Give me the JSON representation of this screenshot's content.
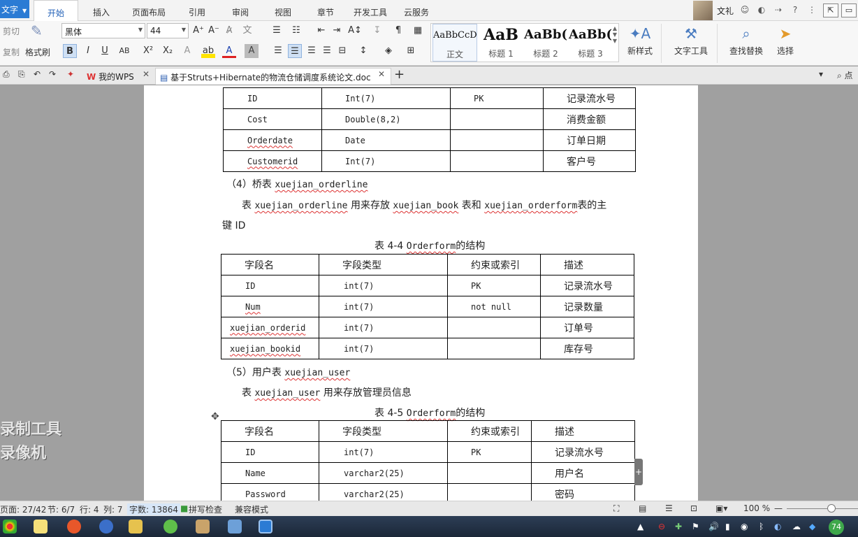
{
  "app_button": "文字",
  "menu_tabs": [
    "开始",
    "插入",
    "页面布局",
    "引用",
    "审阅",
    "视图",
    "章节",
    "开发工具",
    "云服务"
  ],
  "menu_right": {
    "user": "文礼"
  },
  "ribbon": {
    "cut": "剪切",
    "copy": "复制",
    "format_painter": "格式刷",
    "font_name": "黑体",
    "font_size": "44",
    "styles": [
      {
        "sample": "AaBbCcD",
        "name": "正文"
      },
      {
        "sample": "AaB",
        "name": "标题 1"
      },
      {
        "sample": "AaBb(",
        "name": "标题 2"
      },
      {
        "sample": "AaBb(",
        "name": "标题 3"
      }
    ],
    "new_style": "新样式",
    "text_tools": "文字工具",
    "find_replace": "查找替换",
    "select": "选择"
  },
  "tabs": [
    {
      "label": "我的WPS"
    },
    {
      "label": "基于Struts+Hibernate的物流仓储调度系统论文.doc"
    }
  ],
  "doc": {
    "table1": [
      [
        "ID",
        "Int(7)",
        "PK",
        "记录流水号"
      ],
      [
        "Cost",
        "Double(8,2)",
        "",
        "消费金额"
      ],
      [
        "Orderdate",
        "Date",
        "",
        "订单日期"
      ],
      [
        "Customerid",
        "Int(7)",
        "",
        "客户号"
      ]
    ],
    "heading4_prefix": "（4）桥表",
    "heading4_name": "xuejian_orderline",
    "para4": {
      "p1": "表",
      "t1": "xuejian_orderline",
      "p2": "用来存放",
      "t2": "xuejian_book",
      "p3": "表和",
      "t3": "xuejian_orderform",
      "p4": "表的主",
      "line2": "键 ID"
    },
    "caption44": {
      "prefix": "表 4-4",
      "name": "Orderform",
      "suffix": "的结构"
    },
    "table2_header": [
      "字段名",
      "字段类型",
      "约束或索引",
      "描述"
    ],
    "table2": [
      [
        "ID",
        "int(7)",
        "PK",
        "记录流水号"
      ],
      [
        "Num",
        "int(7)",
        "not null",
        "记录数量"
      ],
      [
        "xuejian_orderid",
        "int(7)",
        "",
        "订单号"
      ],
      [
        "xuejian_bookid",
        "int(7)",
        "",
        "库存号"
      ]
    ],
    "heading5_prefix": "（5）用户表",
    "heading5_name": "xuejian_user",
    "para5": {
      "p1": "表",
      "t1": "xuejian_user",
      "p2": "用来存放管理员信息"
    },
    "caption45": {
      "prefix": "表 4-5",
      "name": "Orderform",
      "suffix": "的结构"
    },
    "table3_header": [
      "字段名",
      "字段类型",
      "约束或索引",
      "描述"
    ],
    "table3": [
      [
        "ID",
        "int(7)",
        "PK",
        "记录流水号"
      ],
      [
        "Name",
        "varchar2(25)",
        "",
        "用户名"
      ],
      [
        "Password",
        "varchar2(25)",
        "",
        "密码"
      ]
    ]
  },
  "watermark": {
    "line1": "录制工具",
    "line2": "录像机"
  },
  "status": {
    "page": "页面: 27/42",
    "section": "节: 6/7",
    "row": "行: 4",
    "col": "列: 7",
    "word_count": "字数: 13864",
    "spell": "拼写检查",
    "compat": "兼容模式",
    "zoom": "100 %"
  },
  "taskbar": {
    "badge": "74"
  }
}
